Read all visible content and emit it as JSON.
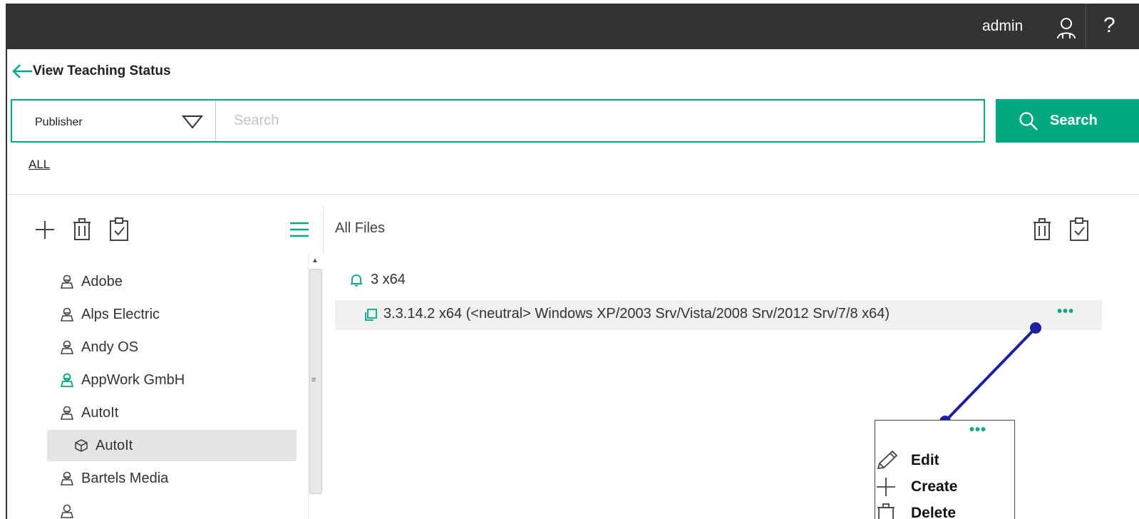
{
  "header": {
    "username": "admin",
    "help_label": "?"
  },
  "page": {
    "back_title": "View Teaching Status"
  },
  "search": {
    "filter_selected": "Publisher",
    "placeholder": "Search",
    "value": "",
    "button_label": "Search"
  },
  "filter_link": "ALL",
  "left_panel": {
    "items": [
      {
        "label": "Adobe",
        "active": false
      },
      {
        "label": "Alps Electric",
        "active": false
      },
      {
        "label": "Andy OS",
        "active": false
      },
      {
        "label": "AppWork GmbH",
        "active": true
      },
      {
        "label": "AutoIt",
        "active": false
      },
      {
        "label": "AutoIt",
        "child": true,
        "selected": true
      },
      {
        "label": "Bartels Media",
        "active": false
      }
    ]
  },
  "right_panel": {
    "title": "All Files",
    "group_label": "3 x64",
    "file_label": "3.3.14.2 x64  (<neutral>  Windows XP/2003 Srv/Vista/2008 Srv/2012 Srv/7/8 x64)"
  },
  "context_menu": {
    "items": [
      "Edit",
      "Create",
      "Delete"
    ]
  },
  "colors": {
    "accent": "#01a982",
    "topbar": "#333333",
    "callout": "#1f1f9e"
  }
}
